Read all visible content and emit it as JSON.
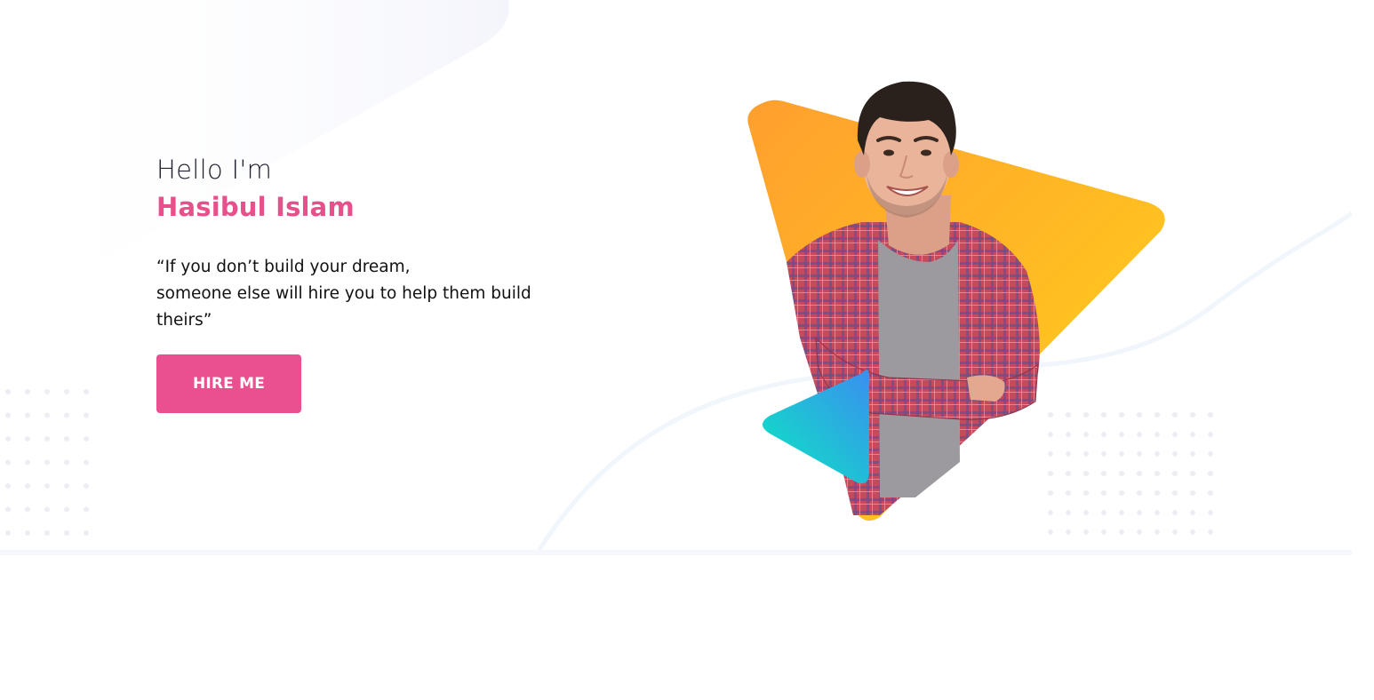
{
  "hero": {
    "greeting": "Hello I'm",
    "name": "Hasibul Islam",
    "quote_line1": "“If you don’t build your dream,",
    "quote_line2": "someone else will hire you to help them build",
    "quote_line3": "theirs”",
    "cta_label": "HIRE ME"
  },
  "portrait": {
    "subject": "smiling-man-plaid-shirt",
    "main_shape_icon": "play-triangle",
    "accent_shape_icon": "play-triangle"
  },
  "colors": {
    "accent_pink": "#ea5090",
    "name_pink": "#e8508c",
    "triangle_orange": "#ff9f2e",
    "triangle_yellow": "#ffd21a",
    "accent_teal": "#0be8c0",
    "accent_blue": "#3a8ff0",
    "background": "#ffffff",
    "soft_shape": "#f6f7fd"
  }
}
